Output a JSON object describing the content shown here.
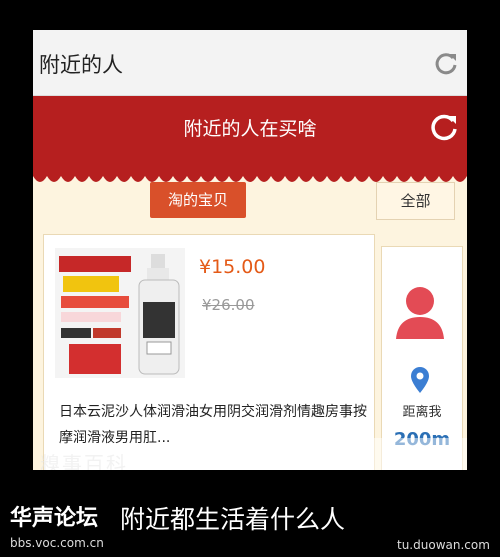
{
  "header": {
    "title": "附近的人"
  },
  "banner": {
    "title": "附近的人在买啥"
  },
  "filters": {
    "taobao_label": "淘的宝贝",
    "all_label": "全部"
  },
  "product": {
    "price": "¥15.00",
    "old_price": "¥26.00",
    "description": "日本云泥沙人体润滑油女用阴交润滑剂情趣房事按摩润滑液男用肛..."
  },
  "nearby": {
    "distance_label": "距离我",
    "distance": "200m"
  },
  "watermark": {
    "left_text": "糗事百科"
  },
  "caption": {
    "forum_logo": "华声论坛",
    "text": "附近都生活着什么人",
    "site_left": "bbs.voc.com.cn",
    "site_right": "tu.duowan.com"
  },
  "colors": {
    "banner_red": "#b61f1f",
    "accent_orange": "#d9502a",
    "price_orange": "#e45a17",
    "distance_blue": "#2a6fb5"
  },
  "icons": [
    "refresh-icon",
    "refresh-icon-large",
    "user-avatar-icon",
    "location-pin-icon"
  ]
}
